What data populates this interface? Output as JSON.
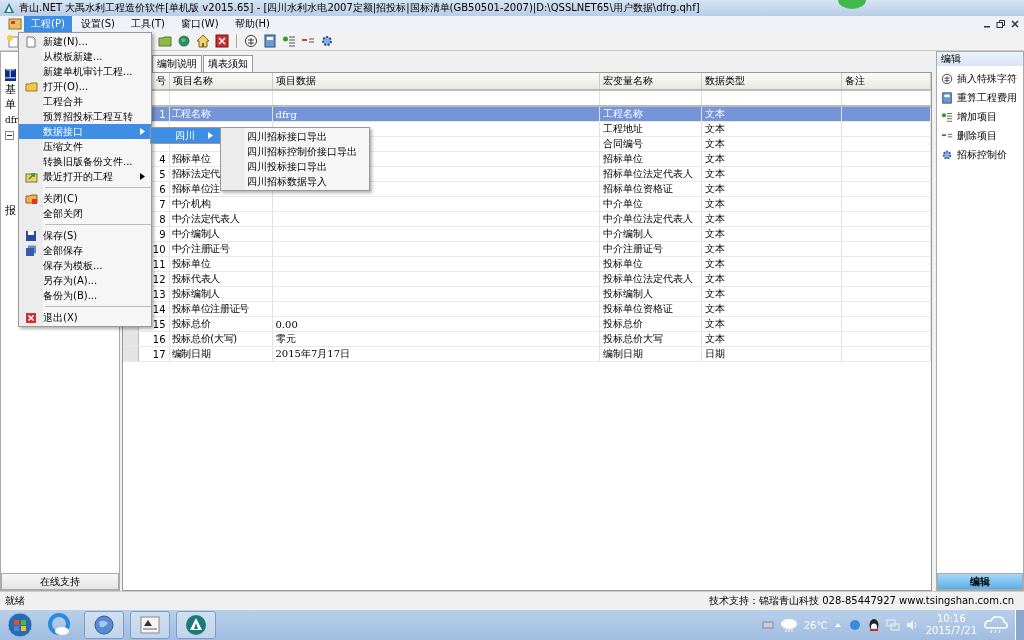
{
  "window": {
    "title": "青山.NET 大禹水利工程造价软件[单机版 v2015.65] - [四川水利水电2007定额|招投标|国标清单(GB50501-2007)|D:\\QSSLNET65\\用户数据\\dfrg.qhf]"
  },
  "menubar": [
    {
      "label": "工程(P)",
      "selected": true
    },
    {
      "label": "设置(S)",
      "selected": false
    },
    {
      "label": "工具(T)",
      "selected": false
    },
    {
      "label": "窗口(W)",
      "selected": false
    },
    {
      "label": "帮助(H)",
      "selected": false
    }
  ],
  "project_menu": [
    {
      "kind": "item",
      "label": "新建(N)...",
      "selected": false,
      "submenu": false
    },
    {
      "kind": "item",
      "label": "从模板新建...",
      "selected": false,
      "submenu": false
    },
    {
      "kind": "item",
      "label": "新建单机审计工程...",
      "selected": false,
      "submenu": false
    },
    {
      "kind": "item",
      "label": "打开(O)...",
      "selected": false,
      "submenu": false
    },
    {
      "kind": "item",
      "label": "工程合并",
      "selected": false,
      "submenu": false
    },
    {
      "kind": "item",
      "label": "预算招投标工程互转",
      "selected": false,
      "submenu": false
    },
    {
      "kind": "item",
      "label": "数据接口",
      "selected": true,
      "submenu": true
    },
    {
      "kind": "item",
      "label": "压缩文件",
      "selected": false,
      "submenu": false
    },
    {
      "kind": "item",
      "label": "转换旧版备份文件...",
      "selected": false,
      "submenu": false
    },
    {
      "kind": "item",
      "label": "最近打开的工程",
      "selected": false,
      "submenu": true
    },
    {
      "kind": "separator"
    },
    {
      "kind": "item",
      "label": "关闭(C)",
      "selected": false,
      "submenu": false
    },
    {
      "kind": "item",
      "label": "全部关闭",
      "selected": false,
      "submenu": false
    },
    {
      "kind": "separator"
    },
    {
      "kind": "item",
      "label": "保存(S)",
      "selected": false,
      "submenu": false
    },
    {
      "kind": "item",
      "label": "全部保存",
      "selected": false,
      "submenu": false
    },
    {
      "kind": "item",
      "label": "保存为模板...",
      "selected": false,
      "submenu": false
    },
    {
      "kind": "item",
      "label": "另存为(A)...",
      "selected": false,
      "submenu": false
    },
    {
      "kind": "item",
      "label": "备份为(B)...",
      "selected": false,
      "submenu": false
    },
    {
      "kind": "separator"
    },
    {
      "kind": "item",
      "label": "退出(X)",
      "selected": false,
      "submenu": false
    }
  ],
  "interface_submenu": [
    {
      "label": "四川",
      "selected": true,
      "submenu": true
    }
  ],
  "sichuan_submenu": [
    {
      "label": "四川招标接口导出"
    },
    {
      "label": "四川招标控制价接口导出"
    },
    {
      "label": "四川投标接口导出"
    },
    {
      "label": "四川招标数据导入"
    }
  ],
  "left_panel": {
    "items": [
      {
        "text": "工",
        "selected": true
      },
      {
        "text": "基",
        "selected": false
      },
      {
        "text": "单",
        "selected": false
      },
      {
        "text": "dfr",
        "selected": false
      },
      {
        "kind": "tree-toggle",
        "expanded": true
      },
      {
        "text": "报",
        "selected": false
      }
    ],
    "button": {
      "label": "在线支持",
      "selected": false
    }
  },
  "tabs": [
    {
      "label": "编制说明",
      "selected": false
    },
    {
      "label": "填表须知",
      "selected": false
    }
  ],
  "table": {
    "columns": [
      "号",
      "项目名称",
      "项目数据",
      "宏变量名称",
      "数据类型",
      "备注"
    ],
    "rows": [
      {
        "no": "1",
        "name": "工程名称",
        "data": "dfrg",
        "macro": "工程名称",
        "type": "文本",
        "selected": true
      },
      {
        "macro": "工程地址",
        "type": "文本",
        "selected": false
      },
      {
        "macro": "合同编号",
        "type": "文本",
        "selected": false
      },
      {
        "no": "4",
        "name": "招标单位",
        "macro": "招标单位",
        "type": "文本",
        "selected": false
      },
      {
        "no": "5",
        "name": "招标法定代",
        "macro": "招标单位法定代表人",
        "type": "文本",
        "selected": false
      },
      {
        "no": "6",
        "name": "招标单位注",
        "macro": "招标单位资格证",
        "type": "文本",
        "selected": false
      },
      {
        "no": "7",
        "name": "中介机构",
        "macro": "中介单位",
        "type": "文本",
        "selected": false
      },
      {
        "no": "8",
        "name": "中介法定代表人",
        "macro": "中介单位法定代表人",
        "type": "文本",
        "selected": false
      },
      {
        "no": "9",
        "name": "中介编制人",
        "macro": "中介编制人",
        "type": "文本",
        "selected": false
      },
      {
        "no": "10",
        "name": "中介注册证号",
        "macro": "中介注册证号",
        "type": "文本",
        "selected": false
      },
      {
        "no": "11",
        "name": "投标单位",
        "macro": "投标单位",
        "type": "文本",
        "selected": false
      },
      {
        "no": "12",
        "name": "投标代表人",
        "macro": "投标单位法定代表人",
        "type": "文本",
        "selected": false
      },
      {
        "no": "13",
        "name": "投标编制人",
        "macro": "投标编制人",
        "type": "文本",
        "selected": false
      },
      {
        "no": "14",
        "name": "投标单位注册证号",
        "macro": "投标单位资格证",
        "type": "文本",
        "selected": false
      },
      {
        "no": "15",
        "name": "投标总价",
        "data": "0.00",
        "macro": "投标总价",
        "type": "文本",
        "selected": false
      },
      {
        "no": "16",
        "name": "投标总价(大写)",
        "data": "零元",
        "macro": "投标总价大写",
        "type": "文本",
        "selected": false
      },
      {
        "no": "17",
        "name": "编制日期",
        "data": "2015年7月17日",
        "macro": "编制日期",
        "type": "日期",
        "selected": false
      }
    ]
  },
  "right_panel": {
    "title": "编辑",
    "items": [
      {
        "label": "插入特殊字符"
      },
      {
        "label": "重算工程费用"
      },
      {
        "label": "增加项目"
      },
      {
        "label": "删除项目"
      },
      {
        "label": "招标控制价"
      }
    ],
    "button": {
      "label": "编辑",
      "selected": true
    }
  },
  "status_bar": {
    "left": "就绪",
    "right": "技术支持：锦瑞青山科技 028-85447927 www.tsingshan.com.cn"
  },
  "taskbar": {
    "temperature": "26℃",
    "time": "10:16",
    "date": "2015/7/21"
  }
}
